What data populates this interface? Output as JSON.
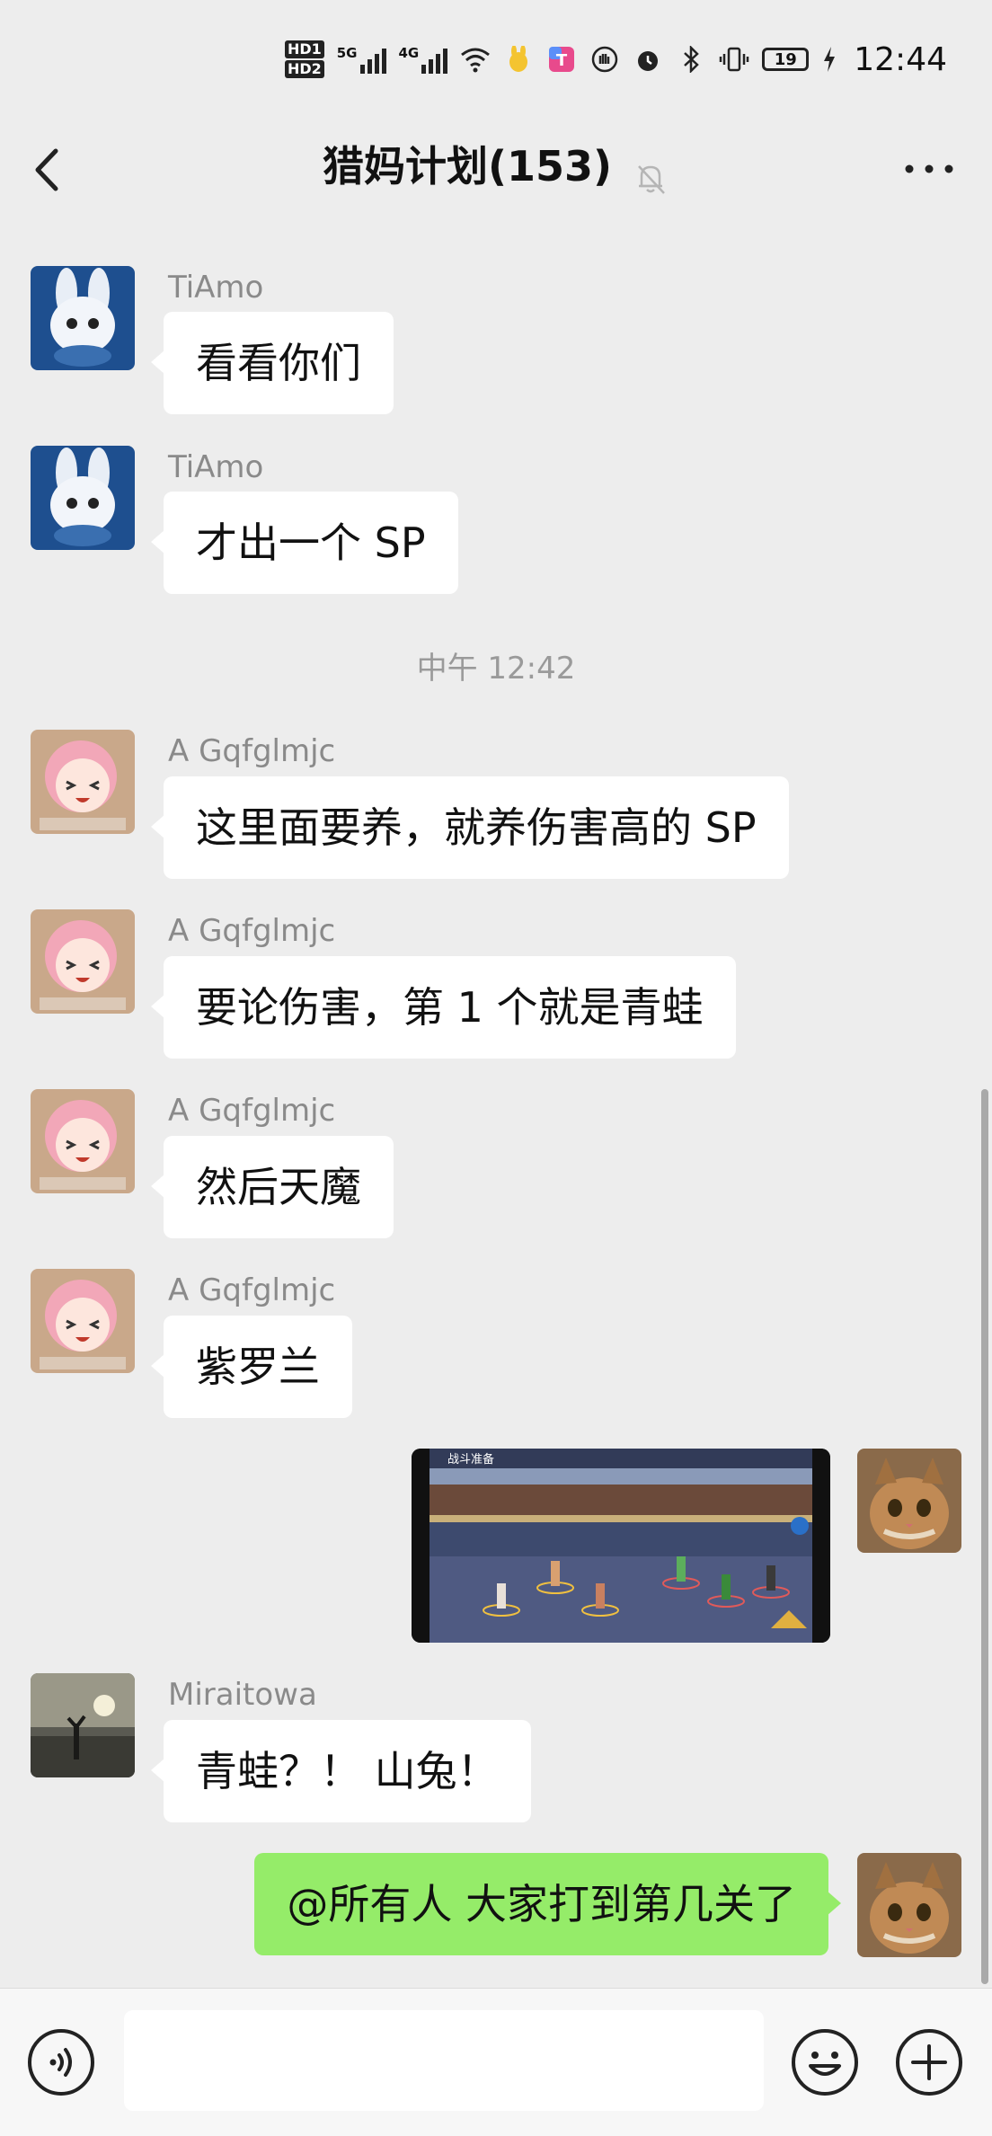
{
  "status_bar": {
    "hd_labels": [
      "HD1",
      "HD2"
    ],
    "network_1": "5G",
    "network_2": "4G",
    "wifi_label": "6",
    "battery": "19",
    "time": "12:44"
  },
  "header": {
    "title": "猎妈计划",
    "member_count": "(153)",
    "back_icon": "chevron-left-icon",
    "mute_icon": "bell-off-icon",
    "more_icon": "more-dots-icon"
  },
  "messages": [
    {
      "sender": "TiAmo",
      "text": "看看你们"
    },
    {
      "sender": "TiAmo",
      "text": "才出一个 SP"
    },
    {
      "timestamp": "中午 12:42"
    },
    {
      "sender": "A Gqfglmjc",
      "text": "这里面要养，就养伤害高的 SP"
    },
    {
      "sender": "A Gqfglmjc",
      "text": "要论伤害，第 1 个就是青蛙"
    },
    {
      "sender": "A Gqfglmjc",
      "text": "然后天魔"
    },
    {
      "sender": "A Gqfglmjc",
      "text": "紫罗兰"
    },
    {
      "sender": "me",
      "image_text": "战斗准备"
    },
    {
      "sender": "Miraitowa",
      "text": "青蛙？！ 山兔！"
    },
    {
      "sender": "me",
      "text": "@所有人   大家打到第几关了"
    }
  ],
  "input_bar": {
    "voice_icon": "voice-icon",
    "emoji_icon": "emoji-icon",
    "plus_icon": "plus-icon",
    "placeholder": ""
  },
  "colors": {
    "background": "#ededed",
    "my_bubble": "#95ec69",
    "other_bubble": "#ffffff"
  }
}
